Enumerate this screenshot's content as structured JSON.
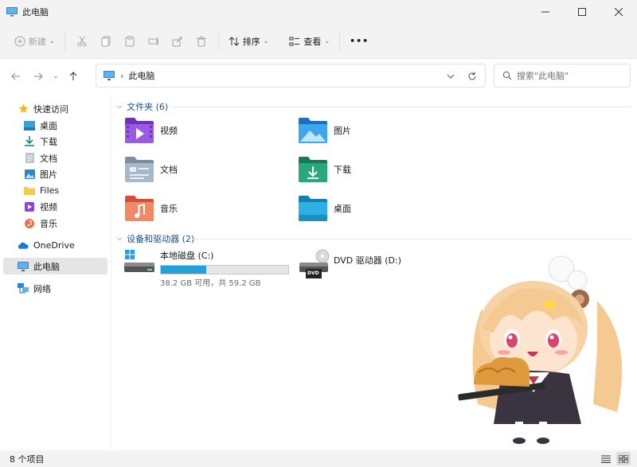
{
  "window": {
    "title": "此电脑"
  },
  "toolbar": {
    "new_label": "新建",
    "sort_label": "排序",
    "view_label": "查看",
    "more_label": "•••"
  },
  "address": {
    "path": "此电脑",
    "chevron": "›"
  },
  "search": {
    "placeholder": "搜索\"此电脑\""
  },
  "sidebar": {
    "quick_access": "快速访问",
    "items": [
      {
        "label": "桌面",
        "icon": "desktop-icon",
        "pinned": true
      },
      {
        "label": "下载",
        "icon": "download-icon",
        "pinned": true
      },
      {
        "label": "文档",
        "icon": "document-icon",
        "pinned": true
      },
      {
        "label": "图片",
        "icon": "picture-icon",
        "pinned": true
      },
      {
        "label": "Files",
        "icon": "folder-icon",
        "pinned": false
      },
      {
        "label": "视频",
        "icon": "video-icon",
        "pinned": false
      },
      {
        "label": "音乐",
        "icon": "music-icon",
        "pinned": false
      }
    ],
    "onedrive": "OneDrive",
    "this_pc": "此电脑",
    "network": "网络"
  },
  "folders": {
    "heading": "文件夹 (6)",
    "items": [
      {
        "label": "视频",
        "icon": "videos-folder-icon"
      },
      {
        "label": "图片",
        "icon": "pictures-folder-icon"
      },
      {
        "label": "文档",
        "icon": "documents-folder-icon"
      },
      {
        "label": "下载",
        "icon": "downloads-folder-icon"
      },
      {
        "label": "音乐",
        "icon": "music-folder-icon"
      },
      {
        "label": "桌面",
        "icon": "desktop-folder-icon"
      }
    ]
  },
  "drives": {
    "heading": "设备和驱动器 (2)",
    "local": {
      "label": "本地磁盘 (C:)",
      "space": "38.2 GB 可用，共 59.2 GB",
      "used_fraction": 0.355
    },
    "dvd": {
      "label": "DVD 驱动器 (D:)",
      "badge": "DVD"
    }
  },
  "status": {
    "count": "8 个项目"
  },
  "colors": {
    "accent": "#26a0da",
    "section_heading": "#1a4f8b"
  }
}
